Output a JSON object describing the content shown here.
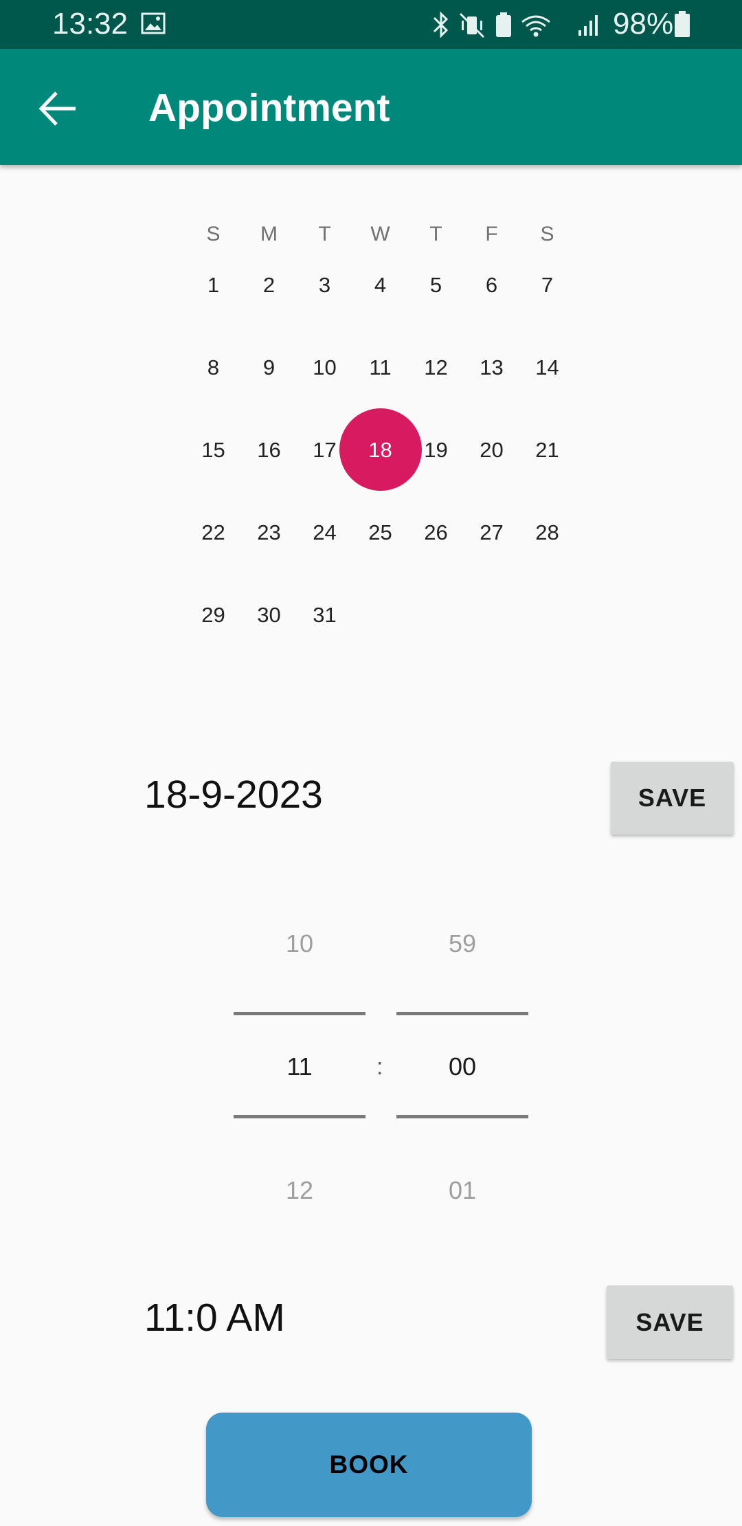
{
  "status_bar": {
    "time": "13:32",
    "battery": "98%",
    "icons": [
      "image-icon",
      "bluetooth-icon",
      "vibrate-icon",
      "battery-saver-icon",
      "wifi-icon",
      "signal-icon",
      "battery-icon"
    ]
  },
  "app_bar": {
    "title": "Appointment",
    "back_icon": "arrow-back-icon",
    "color": "#00897b"
  },
  "calendar": {
    "weekdays": [
      "S",
      "M",
      "T",
      "W",
      "T",
      "F",
      "S"
    ],
    "first_weekday_index": 0,
    "days_in_month": 31,
    "selected_day": 18,
    "selected_color": "#d81b60"
  },
  "date": {
    "value": "18-9-2023",
    "save_label": "SAVE"
  },
  "time_picker": {
    "hour": {
      "prev": "10",
      "current": "11",
      "next": "12"
    },
    "separator": ":",
    "minute": {
      "prev": "59",
      "current": "00",
      "next": "01"
    }
  },
  "time": {
    "value": "11:0 AM",
    "save_label": "SAVE"
  },
  "book": {
    "label": "BOOK",
    "color": "#4298c7"
  }
}
